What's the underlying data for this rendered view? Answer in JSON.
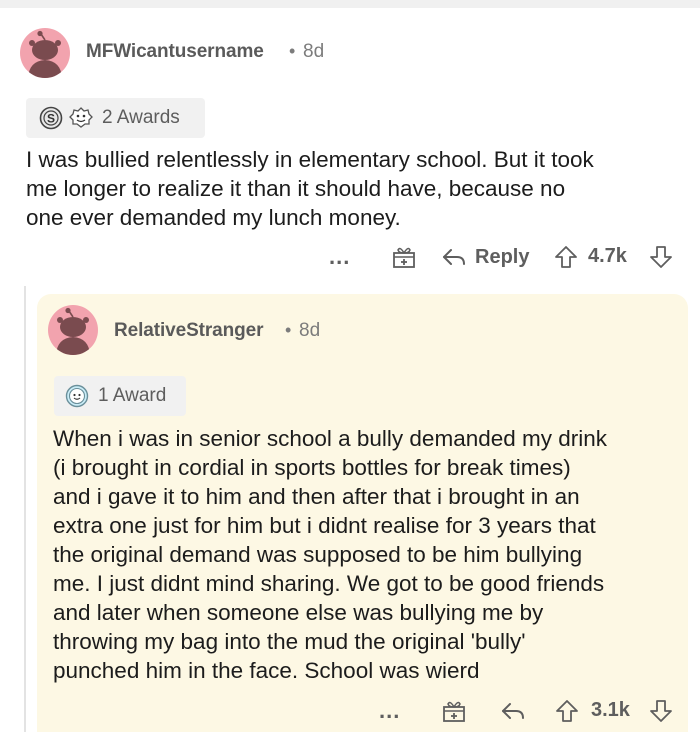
{
  "comment": {
    "username": "MFWicantusername",
    "separator": "•",
    "age": "8d",
    "awards_label": "2 Awards",
    "award_icons": [
      "silver-award-icon",
      "wholesome-seal-icon"
    ],
    "body_lines": [
      "I was bullied relentlessly in elementary school. But it took",
      "me longer to realize it than it should have, because no",
      "one ever demanded my lunch money."
    ],
    "more_label": "...",
    "reply_label": "Reply",
    "vote_count": "4.7k"
  },
  "reply": {
    "username": "RelativeStranger",
    "separator": "•",
    "age": "8d",
    "awards_label": "1 Award",
    "award_icons": [
      "wholesome-award-icon"
    ],
    "body_lines": [
      "When i was in senior school a bully demanded my drink",
      "(i brought in cordial in sports bottles for break times)",
      "and i gave it to him and then after that i brought in an",
      "extra one just for him but i didnt realise for 3 years that",
      "the original demand was supposed to be him bullying",
      "me. I just didnt mind sharing. We got to be good friends",
      "and later when someone else was bullying me by",
      "throwing my bag into the mud the original 'bully'",
      "punched him in the face. School was wierd"
    ],
    "more_label": "...",
    "vote_count": "3.1k"
  },
  "colors": {
    "avatar_bg": "#f2a3ae",
    "reply_card_bg": "#fdf8e4",
    "meta_text": "#7c7c7c"
  }
}
